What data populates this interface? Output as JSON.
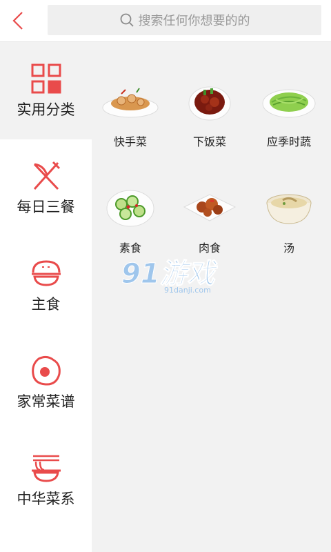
{
  "header": {
    "back_icon": "chevron-left-icon",
    "search_icon": "search-icon",
    "search_placeholder": "搜索任何你想要的的",
    "accent": "#e94b4b"
  },
  "sidebar": {
    "items": [
      {
        "label": "实用分类",
        "icon": "grid-icon",
        "active": true
      },
      {
        "label": "每日三餐",
        "icon": "fork-knife-icon",
        "active": false
      },
      {
        "label": "主食",
        "icon": "rice-bowl-icon",
        "active": false
      },
      {
        "label": "家常菜谱",
        "icon": "fried-egg-icon",
        "active": false
      },
      {
        "label": "中华菜系",
        "icon": "noodle-bowl-icon",
        "active": false
      }
    ]
  },
  "categories": [
    {
      "label": "快手菜",
      "icon": "lotus-root-dish-icon"
    },
    {
      "label": "下饭菜",
      "icon": "braised-meat-dish-icon"
    },
    {
      "label": "应季时蔬",
      "icon": "green-vegetable-dish-icon"
    },
    {
      "label": "素食",
      "icon": "cucumber-dish-icon"
    },
    {
      "label": "肉食",
      "icon": "chicken-dish-icon"
    },
    {
      "label": "汤",
      "icon": "soup-bowl-icon"
    }
  ],
  "watermark": {
    "logo": "91游戏",
    "url": "91danji.com"
  }
}
